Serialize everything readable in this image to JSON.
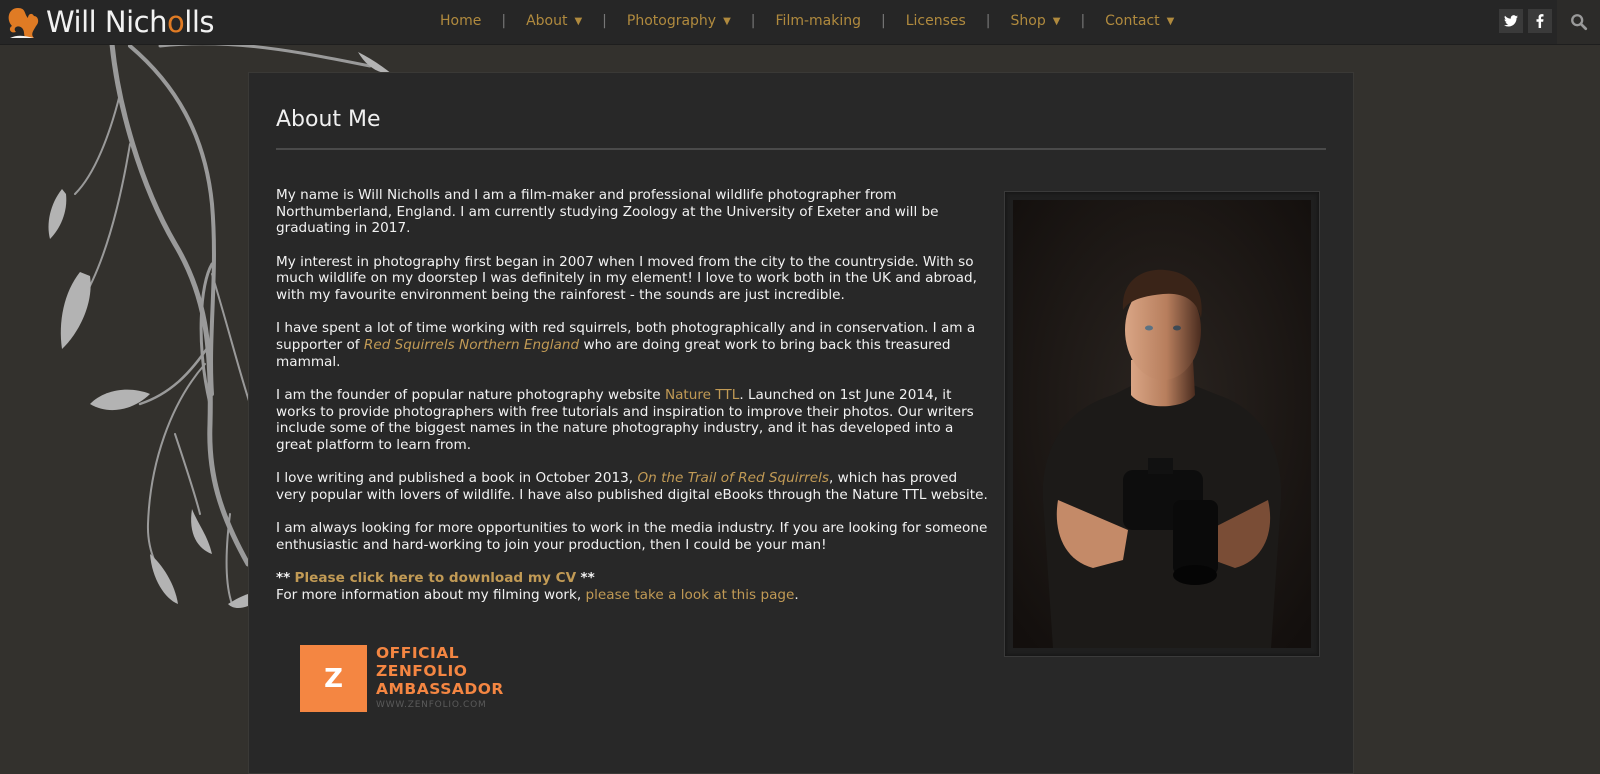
{
  "site": {
    "logo_text_pre": "Will Nich",
    "logo_text_o": "o",
    "logo_text_post": "lls",
    "brand_color": "#b08a3e",
    "accent_orange": "#e07b24"
  },
  "nav": {
    "items": [
      {
        "label": "Home",
        "dropdown": false
      },
      {
        "label": "About",
        "dropdown": true
      },
      {
        "label": "Photography",
        "dropdown": true
      },
      {
        "label": "Film-making",
        "dropdown": false
      },
      {
        "label": "Licenses",
        "dropdown": false
      },
      {
        "label": "Shop",
        "dropdown": true
      },
      {
        "label": "Contact",
        "dropdown": true
      }
    ],
    "separator": "|",
    "caret": "▼"
  },
  "header_icons": {
    "twitter": "twitter-icon",
    "facebook": "facebook-icon",
    "search": "search-icon"
  },
  "page": {
    "title": "About Me",
    "paragraphs": {
      "p1": "My name is Will Nicholls and I am a film-maker and professional wildlife photographer from Northumberland, England. I am currently studying Zoology at the University of Exeter and will be graduating in 2017.",
      "p2": "My interest in photography first began in 2007 when I moved from the city to the countryside. With so much wildlife on my doorstep I was definitely in my element! I love to work both in the UK and abroad, with my favourite environment being the rainforest - the sounds are just incredible.",
      "p3_a": "I have spent a lot of time working with red squirrels, both photographically and in conservation. I am a supporter of ",
      "p3_link": "Red Squirrels Northern England",
      "p3_b": " who are doing great work to bring back this treasured mammal.",
      "p4_a": "I am the founder of popular nature photography website ",
      "p4_link": "Nature TTL",
      "p4_b": ". Launched on 1st June 2014, it works to provide photographers with free tutorials and inspiration to improve their photos. Our writers include some of the biggest names in the nature photography industry, and it has developed into a great platform to learn from.",
      "p5_a": "I love writing and published a book in October 2013, ",
      "p5_link": "On the Trail of Red Squirrels",
      "p5_b": ", which has proved very popular with lovers of wildlife. I have also published digital eBooks through the Nature TTL website.",
      "p6": "I am always looking for more opportunities to work in the media industry. If you are looking for someone enthusiastic and hard-working to join your production, then I could be your man!",
      "cv_stars": "**",
      "cv_link": "Please click here to download my CV",
      "film_a": "For more information about my filming work, ",
      "film_link": "please take a look at this page",
      "film_b": "."
    },
    "portrait_alt": "Portrait of Will Nicholls holding a camera"
  },
  "badge": {
    "letter": "Z",
    "line1": "OFFICIAL",
    "line2": "ZENFOLIO",
    "line3": "AMBASSADOR",
    "url": "WWW.ZENFOLIO.COM",
    "color": "#f48642"
  }
}
